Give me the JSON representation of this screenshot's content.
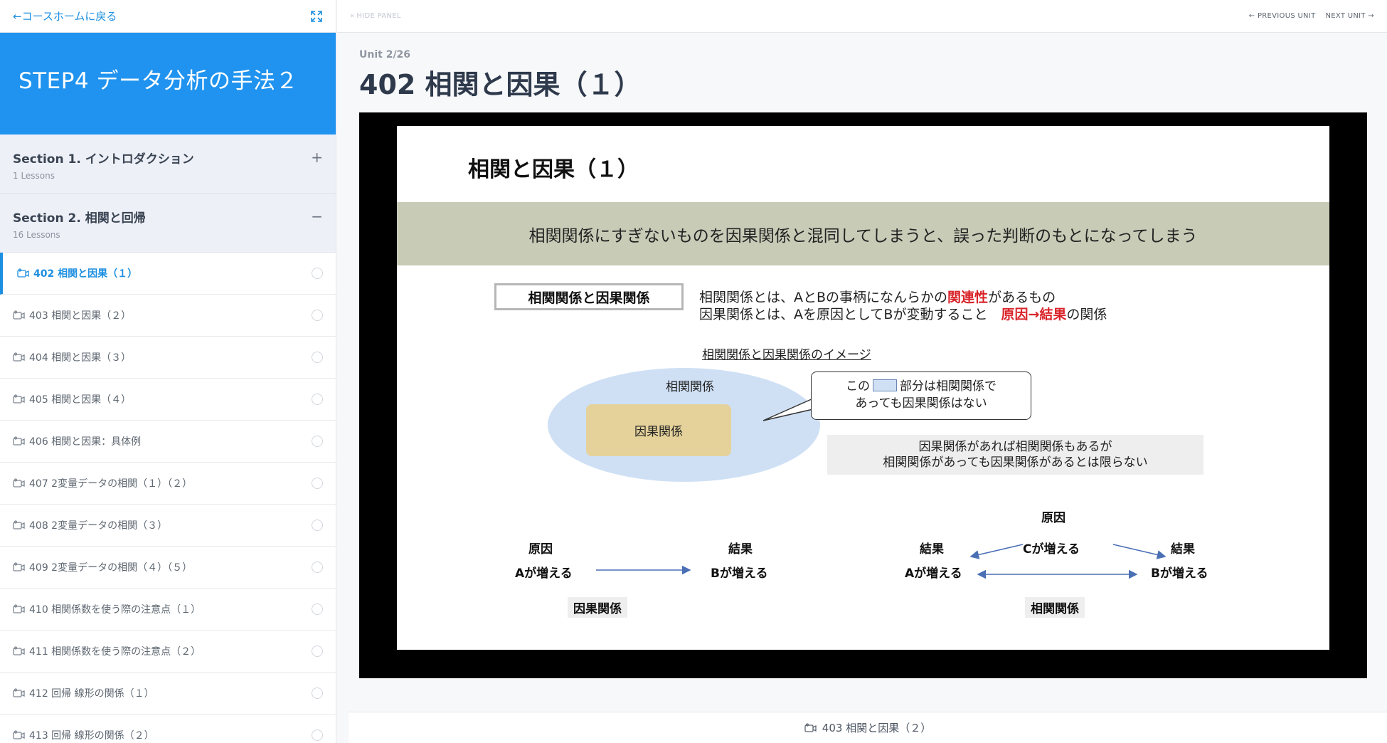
{
  "sidebar": {
    "back_label": "←コースホームに戻る",
    "course_title": "STEP4 データ分析の手法２",
    "sections": [
      {
        "title": "Section 1. イントロダクション",
        "sub": "1 Lessons",
        "toggle": "+"
      },
      {
        "title": "Section 2. 相関と回帰",
        "sub": "16 Lessons",
        "toggle": "−"
      }
    ],
    "lessons": [
      "402 相関と因果（１）",
      "403 相関と因果（２）",
      "404 相関と因果（３）",
      "405 相関と因果（４）",
      "406 相関と因果：具体例",
      "407 2変量データの相関（１）（２）",
      "408 2変量データの相関（３）",
      "409 2変量データの相関（４）（５）",
      "410 相関係数を使う際の注意点（１）",
      "411 相関係数を使う際の注意点（２）",
      "412 回帰 線形の関係（１）",
      "413 回帰 線形の関係（２）"
    ]
  },
  "topbar": {
    "hide_panel": "HIDE PANEL",
    "prev_unit": "PREVIOUS UNIT",
    "next_unit": "NEXT UNIT"
  },
  "main": {
    "unit_count": "Unit 2/26",
    "title": "402 相関と因果（１）"
  },
  "slide": {
    "title": "相関と因果（１）",
    "banner": "相関関係にすぎないものを因果関係と混同してしまうと、誤った判断のもとになってしまう",
    "label_box": "相関関係と因果関係",
    "def1_pre": "相関関係とは、AとBの事柄になんらかの",
    "def1_red": "関連性",
    "def1_post": "があるもの",
    "def2_pre": "因果関係とは、Aを原因としてBが変動すること　",
    "def2_red": "原因→結果",
    "def2_post": "の関係",
    "image_caption": "相関関係と因果関係のイメージ",
    "ellipse_label": "相関関係",
    "inner_label": "因果関係",
    "callout_pre": "この",
    "callout_post": "部分は相関関係で",
    "callout_line2": "あっても因果関係はない",
    "note_line1": "因果関係があれば相関関係もあるが",
    "note_line2": "相関関係があっても因果関係があるとは限らない",
    "left_cause": "原因",
    "left_effect": "結果",
    "left_a": "Aが増える",
    "left_b": "Bが増える",
    "left_caption": "因果関係",
    "right_cause": "原因",
    "right_effect_left": "結果",
    "right_effect_right": "結果",
    "right_c": "Cが増える",
    "right_a": "Aが増える",
    "right_b": "Bが増える",
    "right_caption": "相関関係"
  },
  "next_lesson": {
    "label": "403 相関と因果（２）"
  },
  "colors": {
    "accent": "#1d8fe0",
    "banner": "#1f93ef",
    "slide_band": "#c8ccb7",
    "ellipse": "#cfe0f5",
    "causal_box": "#e5d29b",
    "red": "#d9242a"
  }
}
